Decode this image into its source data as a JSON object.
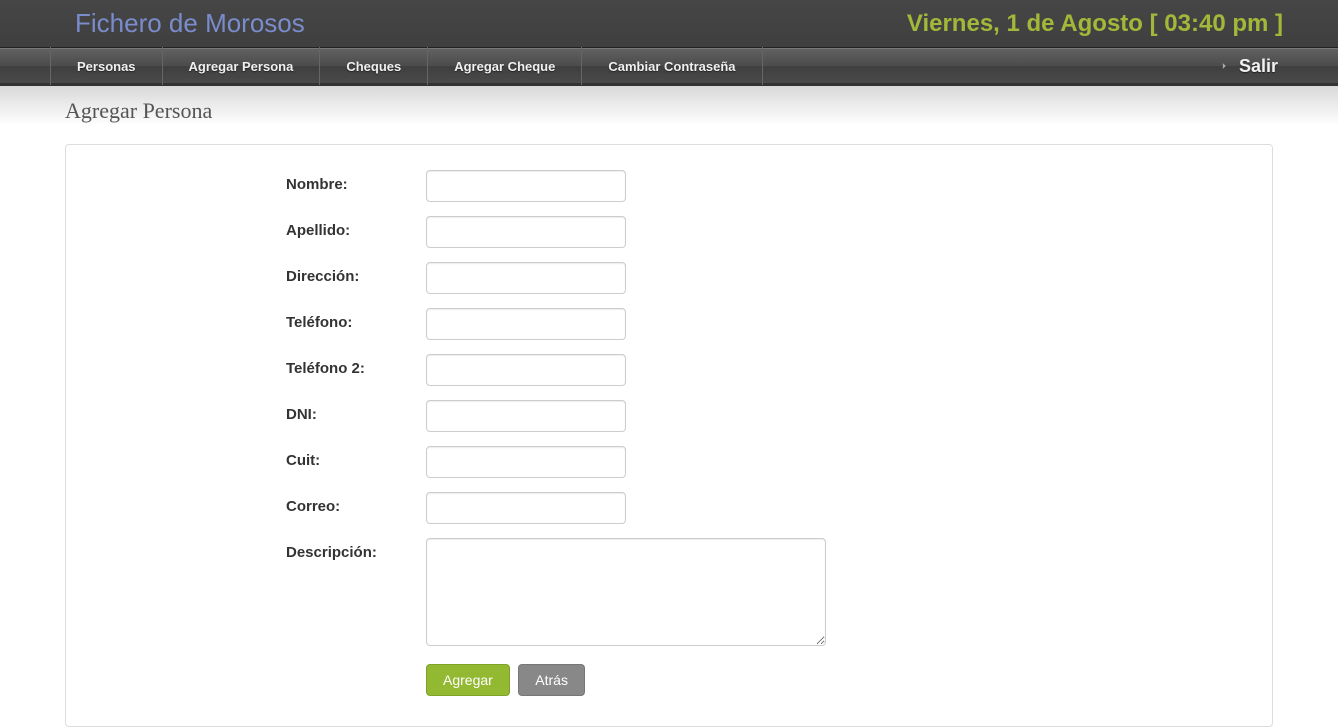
{
  "header": {
    "title": "Fichero de Morosos",
    "date": "Viernes, 1 de Agosto [ 03:40 pm ]"
  },
  "nav": {
    "items": [
      {
        "label": "Personas"
      },
      {
        "label": "Agregar Persona"
      },
      {
        "label": "Cheques"
      },
      {
        "label": "Agregar Cheque"
      },
      {
        "label": "Cambiar Contraseña"
      }
    ],
    "exit": "Salir"
  },
  "page": {
    "heading": "Agregar Persona"
  },
  "form": {
    "fields": [
      {
        "label": "Nombre:",
        "value": ""
      },
      {
        "label": "Apellido:",
        "value": ""
      },
      {
        "label": "Dirección:",
        "value": ""
      },
      {
        "label": "Teléfono:",
        "value": ""
      },
      {
        "label": "Teléfono 2:",
        "value": ""
      },
      {
        "label": "DNI:",
        "value": ""
      },
      {
        "label": "Cuit:",
        "value": ""
      },
      {
        "label": "Correo:",
        "value": ""
      }
    ],
    "textarea": {
      "label": "Descripción:",
      "value": ""
    },
    "buttons": {
      "submit": "Agregar",
      "back": "Atrás"
    }
  }
}
